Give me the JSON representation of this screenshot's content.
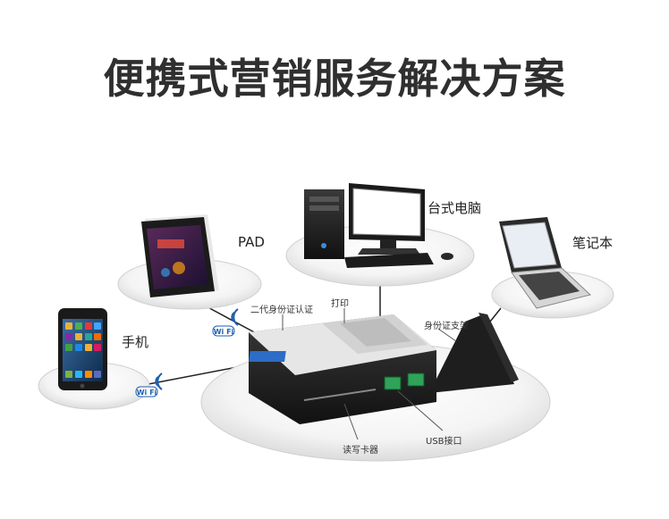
{
  "title": "便携式营销服务解决方案",
  "devices": {
    "phone": "手机",
    "pad": "PAD",
    "desktop": "台式电脑",
    "laptop": "笔记本"
  },
  "callouts": {
    "id_reader": "二代身份证认证",
    "print": "打印",
    "id_stand": "身份证支架",
    "card_reader": "读写卡器",
    "usb": "USB接口"
  },
  "wifi_badge": "Wi Fi",
  "colors": {
    "title": "#2f2f2f",
    "wifi_blue": "#1e5fae",
    "usb_green": "#2fa35a",
    "device_dark": "#1c1c1c"
  }
}
